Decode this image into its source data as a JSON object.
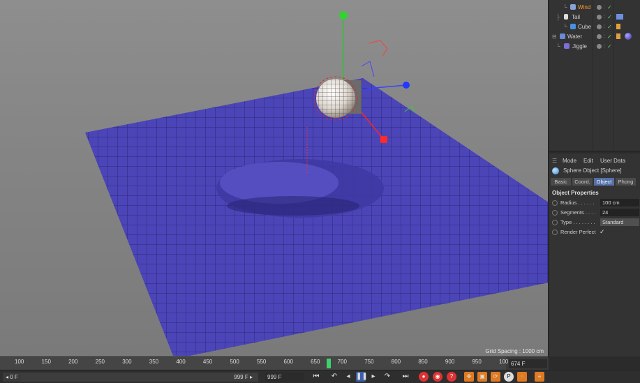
{
  "viewport": {
    "grid_spacing": "Grid Spacing : 1000 cm"
  },
  "object_manager": {
    "items": [
      {
        "name": "Wind",
        "highlight": true
      },
      {
        "name": "Tail"
      },
      {
        "name": "Cube"
      },
      {
        "name": "Water"
      },
      {
        "name": "Jiggle"
      }
    ]
  },
  "attributes": {
    "menu": [
      "Mode",
      "Edit",
      "User Data"
    ],
    "title": "Sphere Object [Sphere]",
    "tabs": [
      "Basic",
      "Coord.",
      "Object",
      "Phong"
    ],
    "active_tab": "Object",
    "section": "Object Properties",
    "props": [
      {
        "label": "Radius . . . . . .",
        "value": "100 cm"
      },
      {
        "label": "Segments . . . .",
        "value": "24"
      },
      {
        "label": "Type . . . . . . . .",
        "value": "Standard"
      },
      {
        "label": "Render Perfect",
        "value": "✓"
      }
    ]
  },
  "timeline": {
    "ticks": [
      "100",
      "150",
      "200",
      "250",
      "300",
      "350",
      "400",
      "450",
      "500",
      "550",
      "600",
      "650",
      "700",
      "750",
      "800",
      "850",
      "900",
      "950",
      "100"
    ],
    "current_frame_fraction": 0.6,
    "frame_field": "674 F"
  },
  "transport": {
    "start": "0 F",
    "end": "999 F",
    "max": "999 F"
  },
  "colors": {
    "plane": "#4b45b8",
    "accent": "#5570a8",
    "playhead": "#3ed36a"
  }
}
